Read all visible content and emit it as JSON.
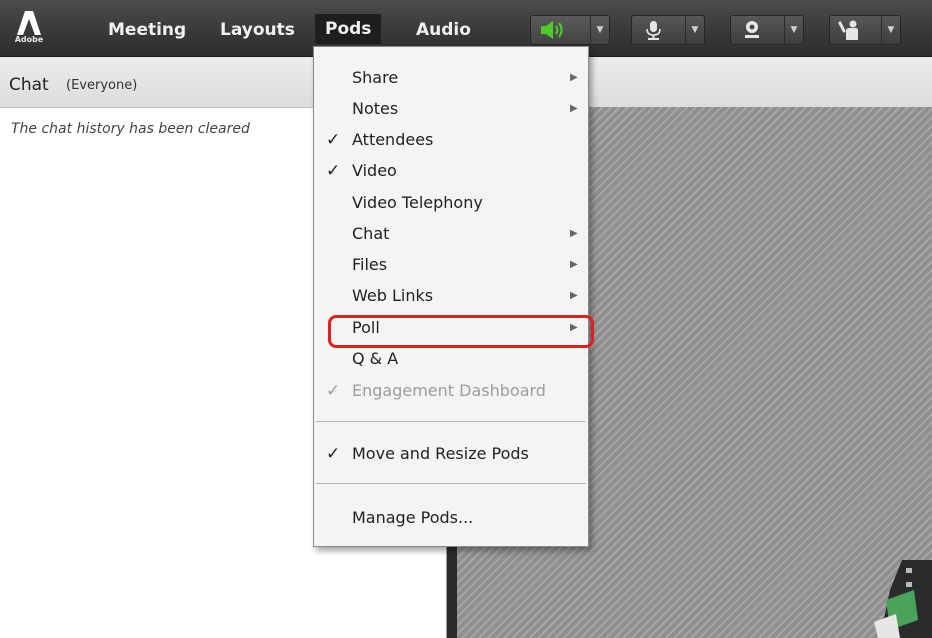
{
  "menubar": {
    "logo_text": "Adobe",
    "items": [
      {
        "label": "Meeting"
      },
      {
        "label": "Layouts"
      },
      {
        "label": "Pods"
      },
      {
        "label": "Audio"
      }
    ],
    "tools": [
      {
        "icon": "speaker-icon",
        "color": "#4dcc2a"
      },
      {
        "icon": "microphone-icon"
      },
      {
        "icon": "webcam-icon"
      },
      {
        "icon": "raise-hand-icon"
      }
    ]
  },
  "chat": {
    "title": "Chat",
    "scope": "(Everyone)",
    "message": "The chat history has been cleared"
  },
  "pods_menu": {
    "items": [
      {
        "label": "Share",
        "checked": false,
        "submenu": true,
        "disabled": false
      },
      {
        "label": "Notes",
        "checked": false,
        "submenu": true,
        "disabled": false
      },
      {
        "label": "Attendees",
        "checked": true,
        "submenu": false,
        "disabled": false
      },
      {
        "label": "Video",
        "checked": true,
        "submenu": false,
        "disabled": false
      },
      {
        "label": "Video Telephony",
        "checked": false,
        "submenu": false,
        "disabled": false
      },
      {
        "label": "Chat",
        "checked": false,
        "submenu": true,
        "disabled": false
      },
      {
        "label": "Files",
        "checked": false,
        "submenu": true,
        "disabled": false
      },
      {
        "label": "Web Links",
        "checked": false,
        "submenu": true,
        "disabled": false
      },
      {
        "label": "Poll",
        "checked": false,
        "submenu": true,
        "disabled": false,
        "highlighted": true
      },
      {
        "label": "Q & A",
        "checked": false,
        "submenu": false,
        "disabled": false
      },
      {
        "label": "Engagement Dashboard",
        "checked": true,
        "submenu": false,
        "disabled": true
      },
      {
        "label": "Move and Resize Pods",
        "checked": true,
        "submenu": false,
        "disabled": false
      },
      {
        "label": "Manage Pods...",
        "checked": false,
        "submenu": false,
        "disabled": false
      }
    ],
    "check_glyph": "✓",
    "submenu_glyph": "▶",
    "highlight_color": "#e0201e"
  }
}
